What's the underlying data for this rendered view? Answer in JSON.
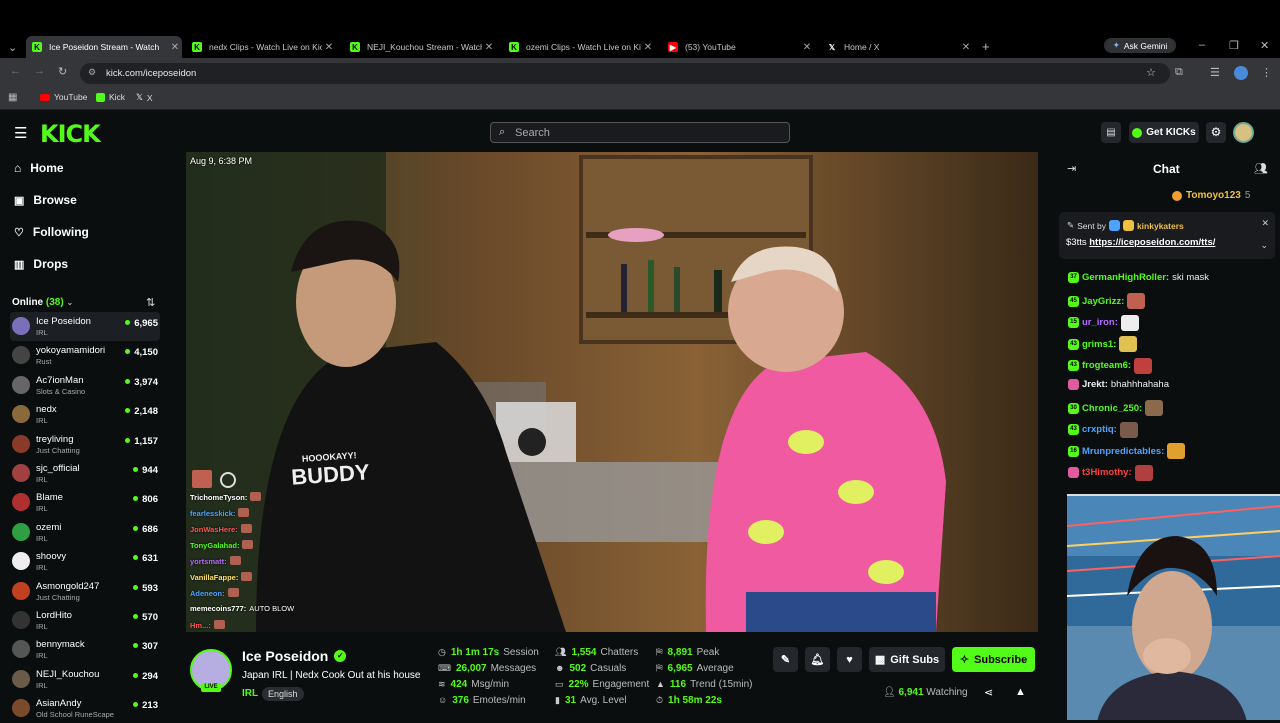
{
  "browser": {
    "tabs": [
      {
        "label": "Ice Poseidon Stream - Watch",
        "favicon": "kick",
        "active": true
      },
      {
        "label": "nedx Clips - Watch Live on Kick",
        "favicon": "kick"
      },
      {
        "label": "NEJI_Kouchou Stream - Watch",
        "favicon": "kick"
      },
      {
        "label": "ozemi Clips - Watch Live on Kick",
        "favicon": "kick"
      },
      {
        "label": "(53) YouTube",
        "favicon": "youtube"
      },
      {
        "label": "Home / X",
        "favicon": "x"
      }
    ],
    "ask_gemini": "Ask Gemini",
    "url": "kick.com/iceposeidon",
    "bookmarks": [
      {
        "label": "YouTube",
        "icon": "youtube"
      },
      {
        "label": "Kick",
        "icon": "kick"
      },
      {
        "label": "X",
        "icon": "x"
      }
    ]
  },
  "header": {
    "logo": "KICK",
    "search_placeholder": "Search",
    "get_kicks": "Get KICKs"
  },
  "sidebar": {
    "nav": [
      {
        "label": "Home",
        "icon": "home-icon"
      },
      {
        "label": "Browse",
        "icon": "browse-icon"
      },
      {
        "label": "Following",
        "icon": "heart-icon"
      },
      {
        "label": "Drops",
        "icon": "drops-icon"
      }
    ],
    "online_label": "Online",
    "online_count": "(38)",
    "channels": [
      {
        "name": "Ice Poseidon",
        "category": "IRL",
        "viewers": "6,965",
        "color": "#7a6fb8"
      },
      {
        "name": "yokoyamamidori",
        "category": "Rust",
        "viewers": "4,150",
        "color": "#444"
      },
      {
        "name": "Ac7ionMan",
        "category": "Slots & Casino",
        "viewers": "3,974",
        "color": "#666"
      },
      {
        "name": "nedx",
        "category": "IRL",
        "viewers": "2,148",
        "color": "#8a6a3a"
      },
      {
        "name": "treyliving",
        "category": "Just Chatting",
        "viewers": "1,157",
        "color": "#8b3a2a"
      },
      {
        "name": "sjc_official",
        "category": "IRL",
        "viewers": "944",
        "color": "#a04040"
      },
      {
        "name": "Blame",
        "category": "IRL",
        "viewers": "806",
        "color": "#b03030"
      },
      {
        "name": "ozemi",
        "category": "IRL",
        "viewers": "686",
        "color": "#2ea043"
      },
      {
        "name": "shoovy",
        "category": "IRL",
        "viewers": "631",
        "color": "#eeeeee"
      },
      {
        "name": "Asmongold247",
        "category": "Just Chatting",
        "viewers": "593",
        "color": "#c04020"
      },
      {
        "name": "LordHito",
        "category": "IRL",
        "viewers": "570",
        "color": "#333"
      },
      {
        "name": "bennymack",
        "category": "IRL",
        "viewers": "307",
        "color": "#555"
      },
      {
        "name": "NEJI_Kouchou",
        "category": "IRL",
        "viewers": "294",
        "color": "#6a5a4a"
      },
      {
        "name": "AsianAndy",
        "category": "Old School RuneScape",
        "viewers": "213",
        "color": "#7a4a2a"
      }
    ]
  },
  "video": {
    "timestamp": "Aug 9, 6:38 PM",
    "shirt_text_1": "HOOOKAYY!",
    "shirt_text_2": "BUDDY",
    "overlay_chat": [
      {
        "user": "TrichomeTyson:",
        "color": "#ffffff"
      },
      {
        "user": "fearlesskick:",
        "color": "#4da3ff"
      },
      {
        "user": "JonWasHere:",
        "color": "#ff5555"
      },
      {
        "user": "TonyGalahad:",
        "color": "#53fc18"
      },
      {
        "user": "yortsmatt:",
        "color": "#b36bff"
      },
      {
        "user": "VanillaFappe:",
        "color": "#ffe066"
      },
      {
        "user": "Adeneon:",
        "color": "#4da3ff"
      },
      {
        "user": "memecoins777:",
        "color": "#ffffff",
        "text": "AUTO BLOW"
      },
      {
        "user": "Hm...:",
        "color": "#ff5555"
      }
    ]
  },
  "stream_info": {
    "streamer": "Ice Poseidon",
    "title": "Japan IRL | Nedx Cook Out at his house",
    "category": "IRL",
    "language": "English",
    "live_badge": "LIVE",
    "stats": [
      {
        "value": "1h 1m 17s",
        "label": "Session"
      },
      {
        "value": "26,007",
        "label": "Messages"
      },
      {
        "value": "424",
        "label": "Msg/min"
      },
      {
        "value": "376",
        "label": "Emotes/min"
      },
      {
        "value": "1,554",
        "label": "Chatters"
      },
      {
        "value": "502",
        "label": "Casuals"
      },
      {
        "value": "22%",
        "label": "Engagement"
      },
      {
        "value": "31",
        "label": "Avg. Level"
      },
      {
        "value": "8,891",
        "label": "Peak"
      },
      {
        "value": "6,965",
        "label": "Average"
      },
      {
        "value": "116",
        "label": "Trend (15min)"
      },
      {
        "value": "1h 58m 22s",
        "label": ""
      }
    ],
    "gift_subs": "Gift Subs",
    "subscribe": "Subscribe",
    "watching_count": "6,941",
    "watching_label": "Watching"
  },
  "chat": {
    "title": "Chat",
    "top_user": "Tomoyo123",
    "top_count": "5",
    "pinned_label": "Sent by",
    "pinned_user": "kinkykaters",
    "pinned_text": "$3tts",
    "pinned_link": "https://iceposeidon.com/tts/",
    "messages": [
      {
        "badge": "37",
        "user": "GermanHighRoller:",
        "color": "#53fc18",
        "text": "ski mask"
      },
      {
        "badge": "45",
        "user": "JayGrizz:",
        "color": "#53fc18",
        "text": "",
        "emote": "#c06050"
      },
      {
        "badge": "15",
        "user": "ur_iron:",
        "color": "#b36bff",
        "text": "",
        "emote": "#eeeeee"
      },
      {
        "badge": "43",
        "user": "grims1:",
        "color": "#53fc18",
        "text": "",
        "emote": "#e0c050"
      },
      {
        "badge": "43",
        "user": "frogteam6:",
        "color": "#53fc18",
        "text": "",
        "emote": "#c04040"
      },
      {
        "badge": "",
        "user": "Jrekt:",
        "color": "#efeff1",
        "text": "bhahhhahaha"
      },
      {
        "badge": "30",
        "user": "Chronic_250:",
        "color": "#53fc18",
        "text": "",
        "emote": "#8a6a4a"
      },
      {
        "badge": "43",
        "user": "crxptiq:",
        "color": "#4da3ff",
        "text": "",
        "emote": "#7a5a4a"
      },
      {
        "badge": "16",
        "user": "Mrunpredictables:",
        "color": "#4da3ff",
        "text": "",
        "emote": "#e0a030"
      },
      {
        "badge": "",
        "user": "t3Himothy:",
        "color": "#ff4040",
        "text": "",
        "emote": "#b04040"
      }
    ]
  },
  "colors": {
    "accent": "#53fc18",
    "bg": "#0b0e0f"
  }
}
